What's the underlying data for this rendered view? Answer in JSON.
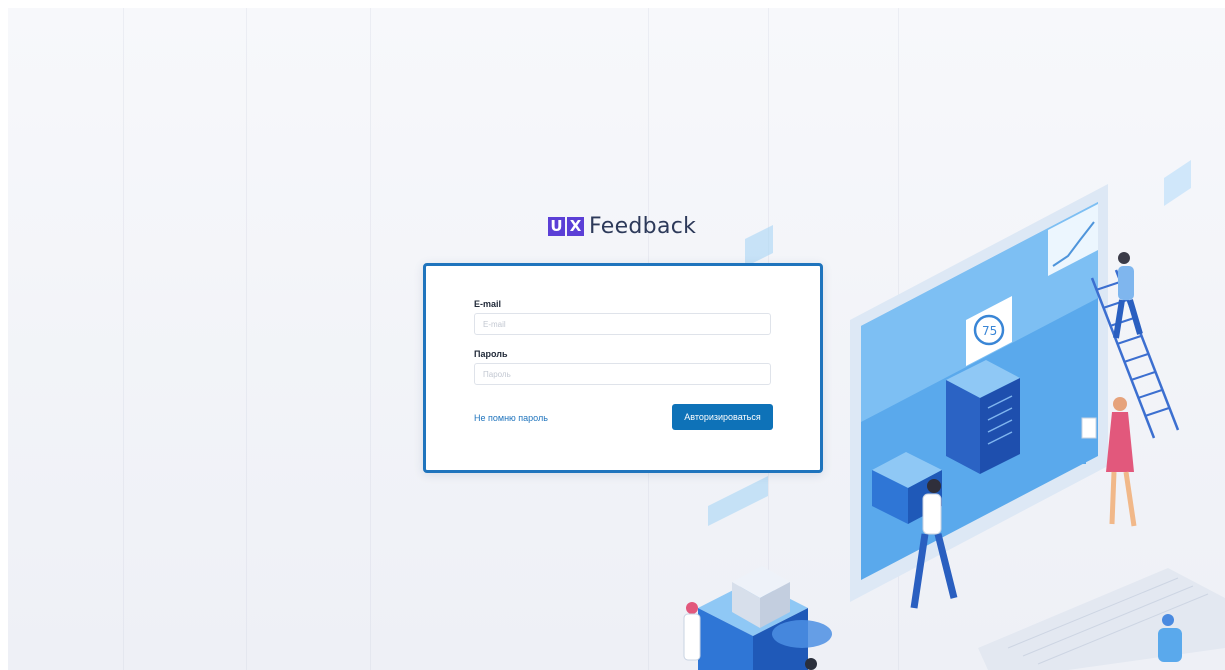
{
  "logo": {
    "letter1": "U",
    "letter2": "X",
    "word": "Feedback"
  },
  "login": {
    "email_label": "E-mail",
    "email_placeholder": "E-mail",
    "email_value": "",
    "password_label": "Пароль",
    "password_placeholder": "Пароль",
    "password_value": "",
    "forgot_label": "Не помню пароль",
    "submit_label": "Авторизироваться"
  },
  "illustration": {
    "counter_value": "75"
  },
  "colors": {
    "brand": "#5b3fd6",
    "accent": "#1f74bd",
    "button": "#0e72b8",
    "background": "#f3f4f8"
  }
}
